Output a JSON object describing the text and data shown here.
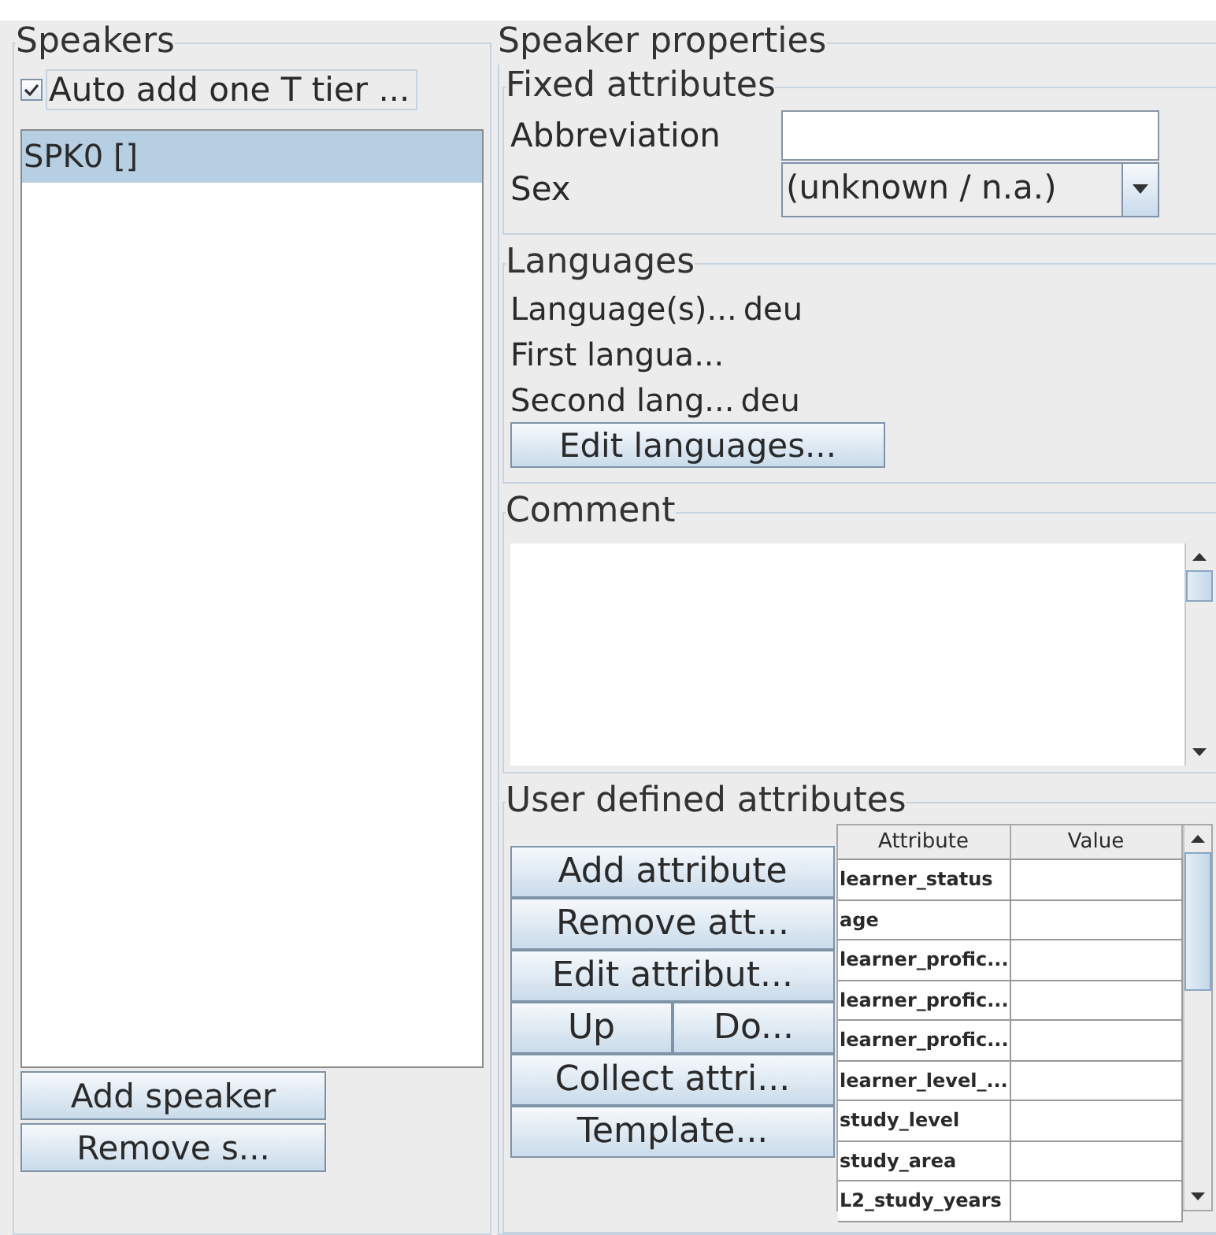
{
  "speakers": {
    "title": "Speakers",
    "auto_tier": {
      "label": "Auto add one T tier ...",
      "checked": true
    },
    "items": [
      {
        "label": "SPK0 []",
        "selected": true
      }
    ],
    "buttons": [
      "Add speaker",
      "Remove s..."
    ]
  },
  "properties": {
    "title": "Speaker properties",
    "fixed": {
      "title": "Fixed attributes",
      "abbreviation_label": "Abbreviation",
      "sex_label": "Sex",
      "sex_value": "(unknown / n.a.)"
    },
    "languages": {
      "title": "Languages",
      "rows": [
        {
          "label": "Language(s)...",
          "value": "deu"
        },
        {
          "label": "First langua..."
        },
        {
          "label": "Second lang...",
          "value": "deu"
        }
      ],
      "button": "Edit languages..."
    },
    "comment": {
      "title": "Comment"
    },
    "user_attributes": {
      "title": "User defined attributes",
      "buttons": [
        [
          "Add attribute"
        ],
        [
          "Remove att..."
        ],
        [
          "Edit attribut..."
        ],
        [
          "Up",
          "Do..."
        ],
        [
          "Collect attri..."
        ],
        [
          "Template..."
        ]
      ],
      "table": {
        "columns": [
          "Attribute",
          "Value"
        ],
        "rows": [
          {
            "attribute": "learner_status"
          },
          {
            "attribute": "age"
          },
          {
            "attribute": "learner_profic..."
          },
          {
            "attribute": "learner_profic..."
          },
          {
            "attribute": "learner_profic..."
          },
          {
            "attribute": "learner_level_..."
          },
          {
            "attribute": "study_level"
          },
          {
            "attribute": "study_area"
          },
          {
            "attribute": "L2_study_years"
          }
        ]
      }
    }
  }
}
